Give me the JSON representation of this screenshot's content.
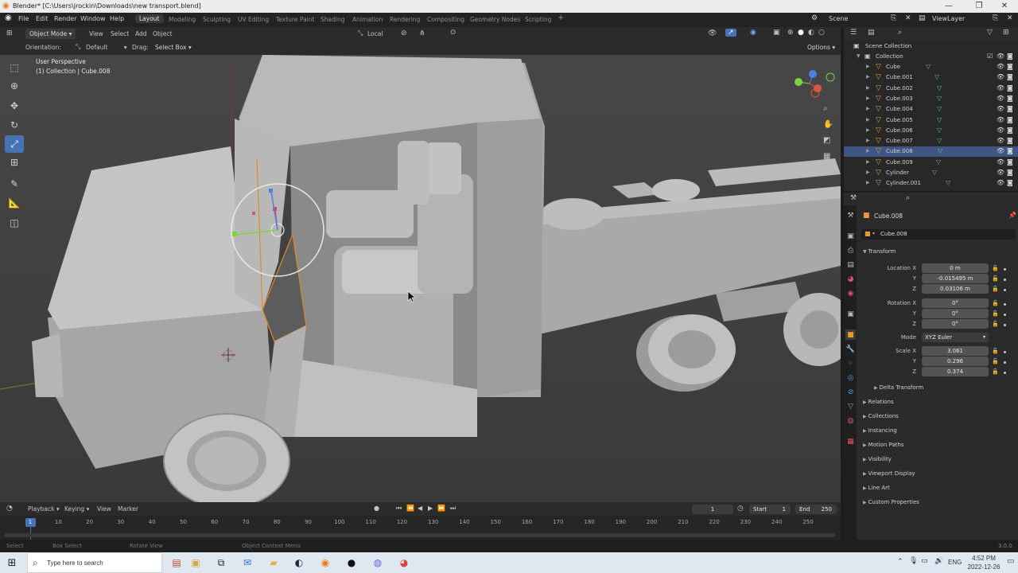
{
  "window": {
    "title": "Blender* [C:\\Users\\jrockin\\Downloads\\new transport.blend]"
  },
  "menus": [
    "File",
    "Edit",
    "Render",
    "Window",
    "Help"
  ],
  "workspaces": [
    "Layout",
    "Modeling",
    "Sculpting",
    "UV Editing",
    "Texture Paint",
    "Shading",
    "Animation",
    "Rendering",
    "Compositing",
    "Geometry Nodes",
    "Scripting"
  ],
  "scene": {
    "name": "Scene",
    "view_layer": "ViewLayer"
  },
  "viewport_header": {
    "mode": "Object Mode",
    "menus": [
      "View",
      "Select",
      "Add",
      "Object"
    ],
    "transform_orientation": "Local",
    "options": "Options"
  },
  "tool_options": {
    "orientation_label": "Orientation:",
    "orientation": "Default",
    "drag_label": "Drag:",
    "drag": "Select Box"
  },
  "overlay": {
    "view_name": "User Perspective",
    "object_info": "(1) Collection | Cube.008"
  },
  "outliner": {
    "scene_collection": "Scene Collection",
    "collection": "Collection",
    "items": [
      "Cube",
      "Cube.001",
      "Cube.002",
      "Cube.003",
      "Cube.004",
      "Cube.005",
      "Cube.006",
      "Cube.007",
      "Cube.008",
      "Cube.009",
      "Cylinder",
      "Cylinder.001"
    ],
    "selected": "Cube.008"
  },
  "properties": {
    "object_name": "Cube.008",
    "data_name": "Cube.008",
    "transform_title": "Transform",
    "location_label": "Location X",
    "location": [
      "0 m",
      "-0.015495 m",
      "0.03106 m"
    ],
    "rotation_label": "Rotation X",
    "rotation": [
      "0°",
      "0°",
      "0°"
    ],
    "mode_label": "Mode",
    "mode": "XYZ Euler",
    "scale_label": "Scale X",
    "scale": [
      "3.061",
      "0.296",
      "0.374"
    ],
    "axis_y": "Y",
    "axis_z": "Z",
    "sections": [
      "Delta Transform",
      "Relations",
      "Collections",
      "Instancing",
      "Motion Paths",
      "Visibility",
      "Viewport Display",
      "Line Art",
      "Custom Properties"
    ]
  },
  "timeline": {
    "menus": [
      "Playback",
      "Keying",
      "View",
      "Marker"
    ],
    "current_frame": "1",
    "start_label": "Start",
    "start": "1",
    "end_label": "End",
    "end": "250",
    "ticks": [
      "1",
      "10",
      "20",
      "30",
      "40",
      "50",
      "60",
      "70",
      "80",
      "90",
      "100",
      "110",
      "120",
      "130",
      "140",
      "150",
      "160",
      "170",
      "180",
      "190",
      "200",
      "210",
      "220",
      "230",
      "240",
      "250"
    ]
  },
  "statusbar": {
    "items": [
      "Select",
      "Box Select",
      "Rotate View",
      "Object Context Menu"
    ],
    "version": "3.0.0"
  },
  "taskbar": {
    "search_placeholder": "Type here to search",
    "lang": "ENG",
    "time": "4:52 PM",
    "date": "2022-12-26"
  }
}
